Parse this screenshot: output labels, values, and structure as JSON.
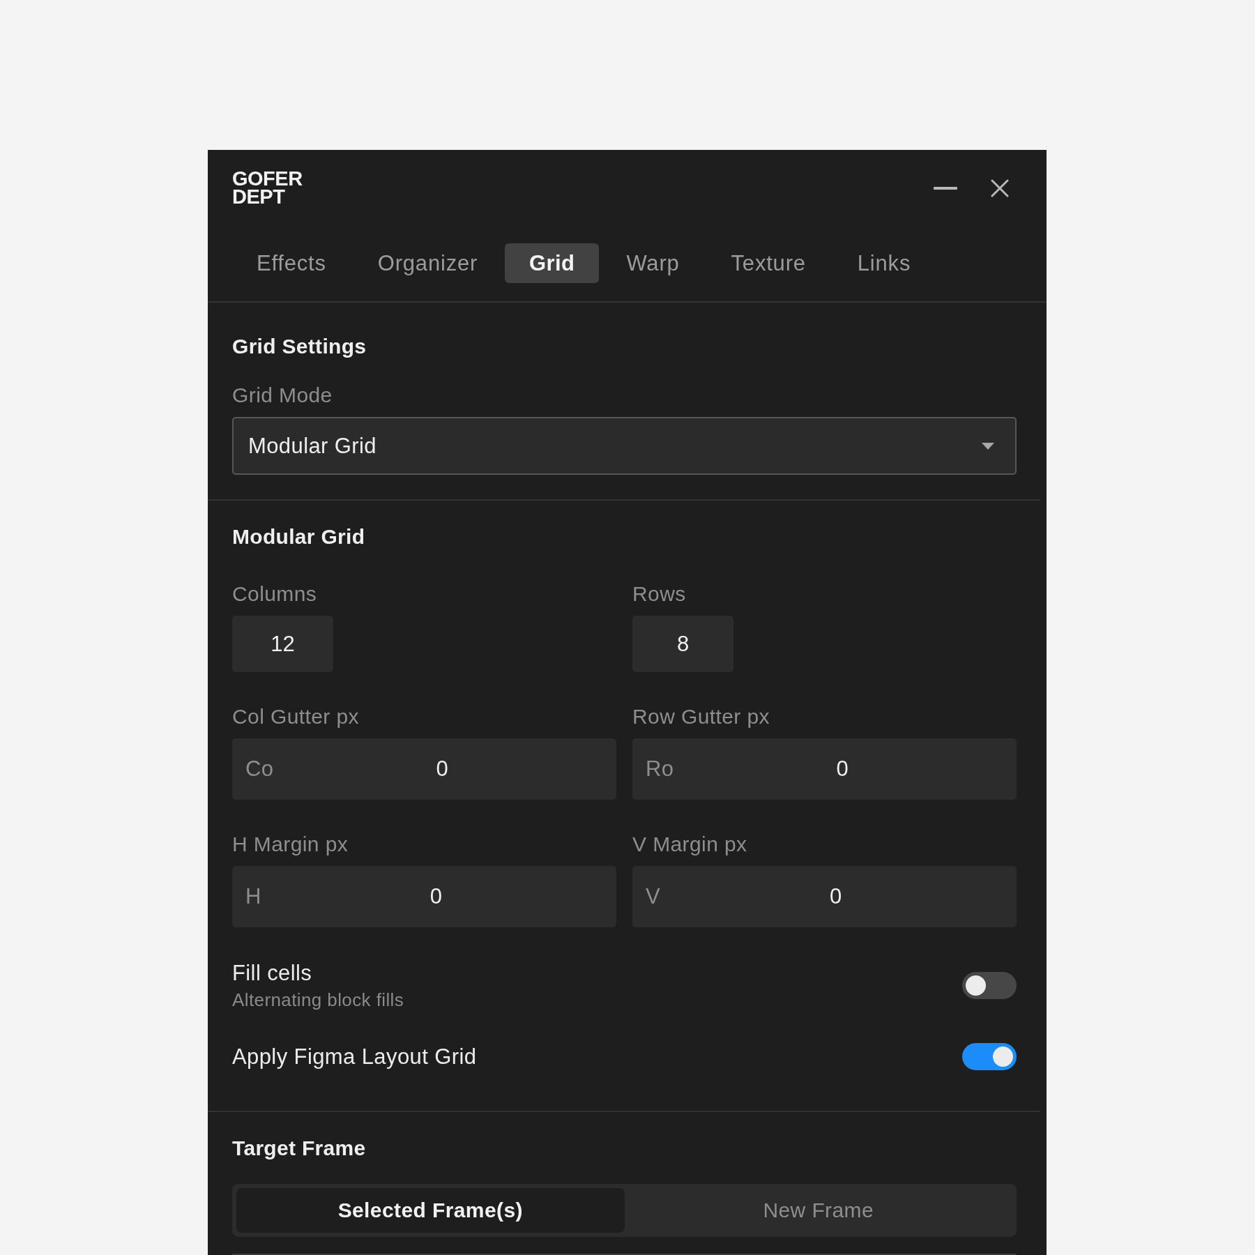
{
  "window": {
    "logo": "GOFER DEPT"
  },
  "tabs": [
    {
      "label": "Effects",
      "selected": false
    },
    {
      "label": "Organizer",
      "selected": false
    },
    {
      "label": "Grid",
      "selected": true
    },
    {
      "label": "Warp",
      "selected": false
    },
    {
      "label": "Texture",
      "selected": false
    },
    {
      "label": "Links",
      "selected": false
    }
  ],
  "grid_settings": {
    "title": "Grid Settings",
    "grid_mode": {
      "label": "Grid Mode",
      "value": "Modular Grid"
    }
  },
  "modular_grid": {
    "title": "Modular Grid",
    "fields": [
      {
        "kind": "small",
        "label": "Columns",
        "value": "12"
      },
      {
        "kind": "small",
        "label": "Rows",
        "value": "8"
      },
      {
        "kind": "prefixed",
        "label": "Col Gutter px",
        "prefix": "Co",
        "value": "0"
      },
      {
        "kind": "prefixed",
        "label": "Row Gutter px",
        "prefix": "Ro",
        "value": "0"
      },
      {
        "kind": "prefixed",
        "label": "H Margin px",
        "prefix": "H",
        "value": "0"
      },
      {
        "kind": "prefixed",
        "label": "V Margin px",
        "prefix": "V",
        "value": "0"
      }
    ],
    "toggles": [
      {
        "label": "Fill cells",
        "description": "Alternating block fills",
        "on": false
      },
      {
        "label": "Apply Figma Layout Grid",
        "on": true
      }
    ]
  },
  "target_frame": {
    "title": "Target Frame",
    "options": [
      {
        "label": "Selected Frame(s)",
        "selected": true
      },
      {
        "label": "New Frame",
        "selected": false
      }
    ]
  }
}
